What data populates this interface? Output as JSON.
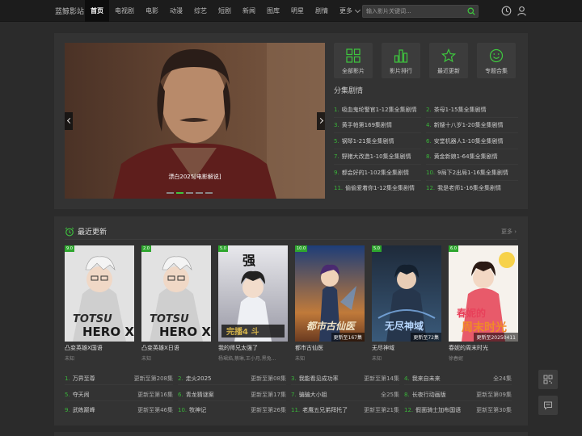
{
  "header": {
    "logo": "蓝鲸影站",
    "nav": [
      "首页",
      "电视剧",
      "电影",
      "动漫",
      "综艺",
      "短剧",
      "新闻",
      "图库",
      "明星",
      "剧情"
    ],
    "more": "更多",
    "search_placeholder": "输入影片关键词..."
  },
  "hero": {
    "banner_caption": "漂白2025[电影解说]",
    "quick_links": [
      "全部影片",
      "影片排行",
      "最近更新",
      "专题合集"
    ],
    "section_title": "分集剧情",
    "episodes": [
      {
        "num": "1.",
        "title": "吸血鬼纶警官1-12集全集剧情"
      },
      {
        "num": "2.",
        "title": "茶母1-15集全集剧情"
      },
      {
        "num": "3.",
        "title": "黄手帕第169集剧情"
      },
      {
        "num": "4.",
        "title": "新嫂十八岁1-20集全集剧情"
      },
      {
        "num": "5.",
        "title": "钢琴1-21集全集剧情"
      },
      {
        "num": "6.",
        "title": "安堂机器人1-10集全集剧情"
      },
      {
        "num": "7.",
        "title": "野猪大改造1-10集全集剧情"
      },
      {
        "num": "8.",
        "title": "黄金新娘1-64集全集剧情"
      },
      {
        "num": "9.",
        "title": "都会好的1-102集全集剧情"
      },
      {
        "num": "10.",
        "title": "9局下2出局1-16集全集剧情"
      },
      {
        "num": "11.",
        "title": "偷偷爱着你1-12集全集剧情"
      },
      {
        "num": "12.",
        "title": "我是老师1-16集全集剧情"
      }
    ]
  },
  "recent": {
    "title": "最近更新",
    "more": "更多",
    "cards": [
      {
        "score": "9.0",
        "title": "凸变英雄X国语",
        "sub": "未知",
        "status": ""
      },
      {
        "score": "2.0",
        "title": "凸变英雄X日语",
        "sub": "未知",
        "status": ""
      },
      {
        "score": "5.0",
        "title": "我的师兄太强了",
        "sub": "杨珺焰,蔡琳,王小月,黑兔...",
        "status": ""
      },
      {
        "score": "10.0",
        "title": "都市古仙医",
        "sub": "未知",
        "status": "更新至167集"
      },
      {
        "score": "5.0",
        "title": "无尽神域",
        "sub": "未知",
        "status": "更新至72集"
      },
      {
        "score": "6.0",
        "title": "春妮的周末时光",
        "sub": "徐春妮",
        "status": "更新至20250411"
      }
    ],
    "list": [
      {
        "num": "1.",
        "title": "万界至尊",
        "update": "更新至第208集"
      },
      {
        "num": "2.",
        "title": "走火2025",
        "update": "更新至第08集"
      },
      {
        "num": "3.",
        "title": "我能看见成功率",
        "update": "更新至第14集"
      },
      {
        "num": "4.",
        "title": "我来自未来",
        "update": "全24集"
      },
      {
        "num": "5.",
        "title": "夺天闹",
        "update": "更新至第16集"
      },
      {
        "num": "6.",
        "title": "青龙猜谜案",
        "update": "更新至第17集"
      },
      {
        "num": "7.",
        "title": "骗骗大小姐",
        "update": "全25集"
      },
      {
        "num": "8.",
        "title": "长夜行动画版",
        "update": "更新至第09集"
      },
      {
        "num": "9.",
        "title": "武练巅峰",
        "update": "更新至第46集"
      },
      {
        "num": "10.",
        "title": "牧神记",
        "update": "更新至第26集"
      },
      {
        "num": "11.",
        "title": "老鹰五兄弟拜托了",
        "update": "更新至第21集"
      },
      {
        "num": "12.",
        "title": "假面骑士加布国语",
        "update": "更新至第30集"
      }
    ]
  }
}
